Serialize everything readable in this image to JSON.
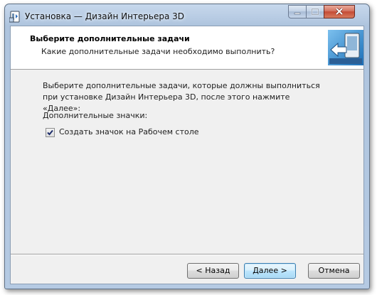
{
  "window": {
    "title": "Установка — Дизайн Интерьера 3D"
  },
  "header": {
    "title": "Выберите дополнительные задачи",
    "subtitle": "Какие дополнительные задачи необходимо выполнить?"
  },
  "body": {
    "instructions": "Выберите дополнительные задачи, которые должны выполниться при установке Дизайн Интерьера 3D, после этого нажмите «Далее»:",
    "group_label": "Дополнительные значки:",
    "tasks": [
      {
        "label": "Создать значок на Рабочем столе",
        "checked": true
      }
    ]
  },
  "buttons": {
    "back": "< Назад",
    "next": "Далее >",
    "cancel": "Отмена"
  },
  "icons": {
    "app": "installer-app-icon",
    "wizard": "install-arrow-icon",
    "minimize": "minimize-icon",
    "maximize": "maximize-icon",
    "close": "close-icon",
    "check": "checkmark-icon"
  },
  "colors": {
    "titlebar": "#b7cbe3",
    "close_button": "#c44a35",
    "default_button_border": "#3c7fb1",
    "dialog_background": "#f0f0f0"
  }
}
